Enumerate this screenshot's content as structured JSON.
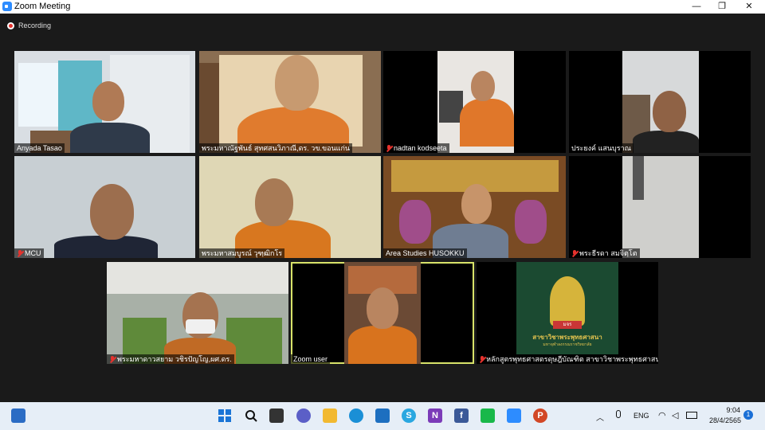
{
  "window": {
    "title": "Zoom Meeting",
    "minimize": "—",
    "maximize": "❐",
    "close": "✕"
  },
  "recording": {
    "label": "Recording"
  },
  "participants": [
    {
      "name": "Anyada Tasao"
    },
    {
      "name": "พระมหาณัฐพันธ์ สุทศสนวิภาณี,ดร. วข.ขอนแก่น"
    },
    {
      "name": "nadtan kodseeta"
    },
    {
      "name": "ประยงค์ แสนบุราณ"
    },
    {
      "name": "MCU"
    },
    {
      "name": "พระมหาสมบูรณ์ วุฑฺฒิกโร"
    },
    {
      "name": "Area Studies HUSOKKU"
    },
    {
      "name": "พระธีรดา สมจิตฺโต"
    },
    {
      "name": "พระมหาดาวสยาม วชิรปัญโญ,ผศ.ดร."
    },
    {
      "name": "Zoom user"
    },
    {
      "name": "หลักสูตรพุทธศาสตรดุษฎีบัณฑิต สาขาวิชาพระพุทธศาสน..."
    }
  ],
  "logo_tile": {
    "caption": "สาขาวิชาพระพุทธศาสนา",
    "subcaption": "มหาจุฬาลงกรณราชวิทยาลัย",
    "seal_text": "มจร"
  },
  "taskbar": {
    "language": "ENG",
    "time": "9:04",
    "date": "28/4/2565",
    "notification_count": "1",
    "icons": [
      "windows-start",
      "search",
      "task-view",
      "chat",
      "file-explorer",
      "edge",
      "mail",
      "skype",
      "onenote",
      "facebook",
      "line",
      "zoom",
      "powerpoint"
    ]
  },
  "colors": {
    "accent": "#2D8CFF",
    "active_speaker": "#d8e36a",
    "muted": "#e5322d",
    "taskbar": "#e6eef7"
  }
}
